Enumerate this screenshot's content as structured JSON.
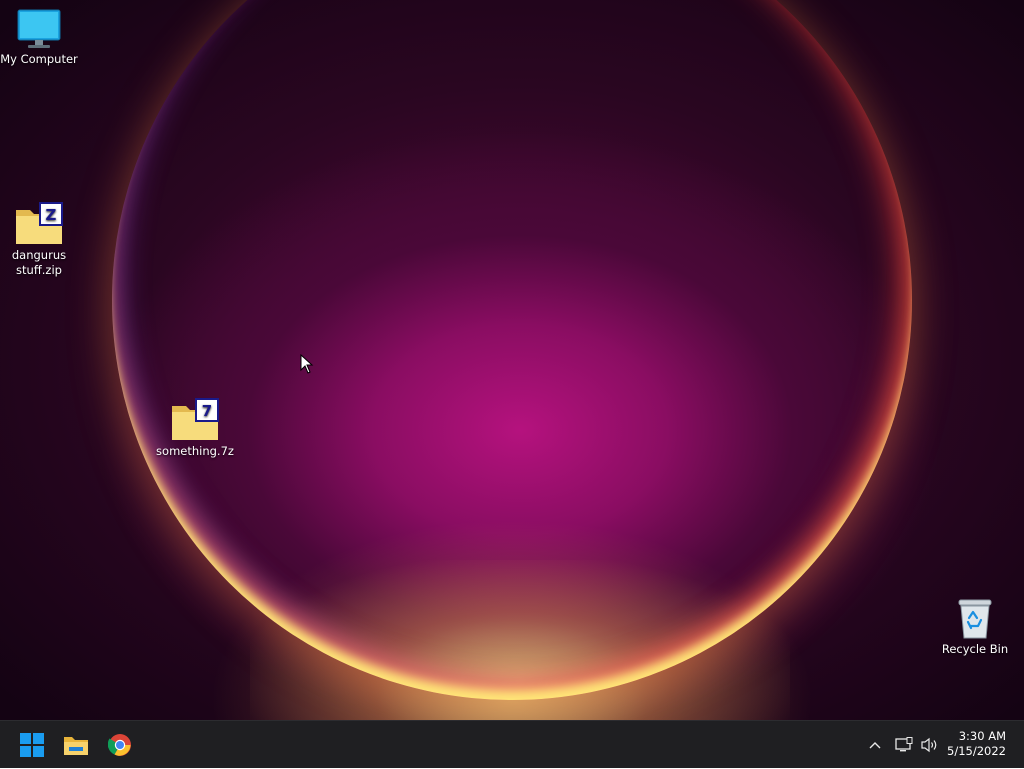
{
  "desktop": {
    "icons": [
      {
        "label": "My Computer",
        "icon": "computer-icon"
      },
      {
        "label": "dangurus stuff.zip",
        "icon": "zip-archive-icon"
      },
      {
        "label": "something.7z",
        "icon": "7z-archive-icon"
      },
      {
        "label": "Recycle Bin",
        "icon": "recycle-bin-icon"
      }
    ]
  },
  "taskbar": {
    "pinned": [
      {
        "name": "Start",
        "icon": "windows-start-icon"
      },
      {
        "name": "File Explorer",
        "icon": "file-explorer-icon"
      },
      {
        "name": "Google Chrome",
        "icon": "chrome-icon"
      }
    ],
    "tray": {
      "icons": [
        "chevron-up-icon",
        "network-icon",
        "volume-icon"
      ],
      "time": "3:30 AM",
      "date": "5/15/2022"
    }
  },
  "colors": {
    "taskbar_bg": "#1f1f22",
    "windows_blue": "#1a9cf0",
    "folder_yellow": "#f3d36c"
  }
}
